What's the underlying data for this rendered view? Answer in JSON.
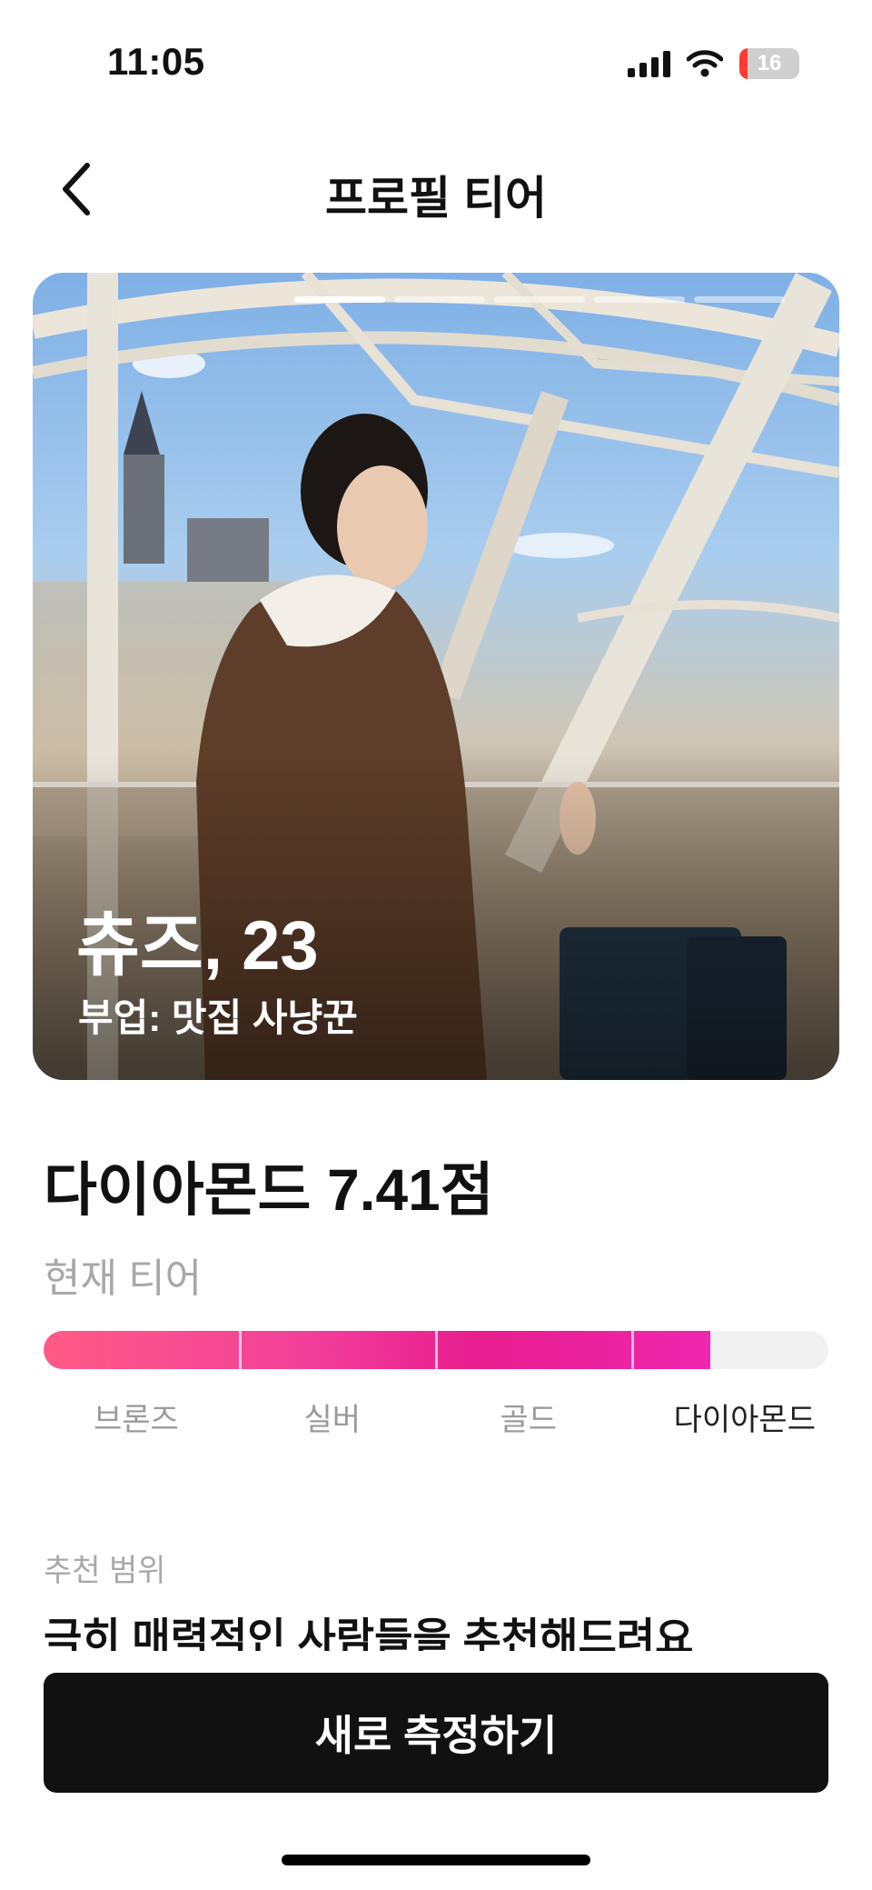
{
  "status_bar": {
    "time": "11:05",
    "battery_level": "16",
    "icons": [
      "signal-icon",
      "wifi-icon",
      "battery-icon"
    ]
  },
  "header": {
    "title": "프로필 티어",
    "back_icon": "chevron-left-icon"
  },
  "profile_card": {
    "name_age": "츄즈, 23",
    "subtitle": "부업: 맛집 사냥꾼",
    "page_count": 5,
    "active_page": 0
  },
  "score": {
    "text": "다이아몬드 7.41점",
    "tier_label": "현재 티어"
  },
  "tier_bar": {
    "fill_fraction": 0.85,
    "tiers": [
      "브론즈",
      "실버",
      "골드",
      "다이아몬드"
    ],
    "current_index": 3,
    "colors": {
      "start": "#ff5a86",
      "end": "#ee27ae",
      "track": "#f1f1f1"
    }
  },
  "recommendation": {
    "label": "추천 범위",
    "text": "극히 매력적인 사람들을 추천해드려요"
  },
  "cta": {
    "label": "새로 측정하기"
  }
}
